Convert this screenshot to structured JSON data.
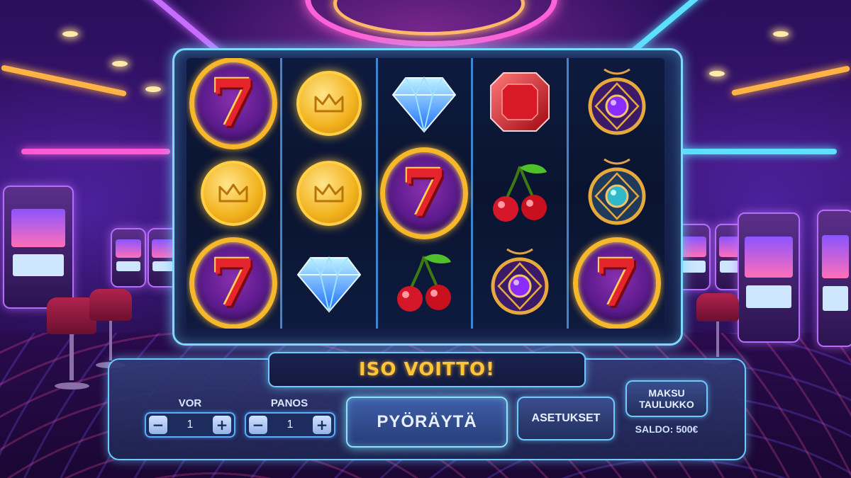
{
  "game": {
    "win_banner": "ISO VOITTO!",
    "reels": [
      [
        "seven",
        "coin",
        "seven"
      ],
      [
        "coin",
        "coin",
        "diamond"
      ],
      [
        "diamond",
        "seven",
        "cherry"
      ],
      [
        "ruby",
        "cherry",
        "amulet-purple"
      ],
      [
        "amulet-purple",
        "amulet-teal",
        "seven"
      ]
    ]
  },
  "controls": {
    "lines": {
      "label": "VOR",
      "value": "1",
      "minus": "−",
      "plus": "+"
    },
    "bet": {
      "label": "PANOS",
      "value": "1",
      "minus": "−",
      "plus": "+"
    },
    "spin_label": "PYÖRÄYTÄ",
    "settings_label": "ASETUKSET",
    "paytable_line1": "MAKSU",
    "paytable_line2": "TAULUKKO",
    "balance": "SALDO: 500€"
  },
  "colors": {
    "accent_neon": "#6fc9ff",
    "win_text": "#ffc53a",
    "seven_red": "#e6242c",
    "coin_gold": "#f2b21d"
  }
}
